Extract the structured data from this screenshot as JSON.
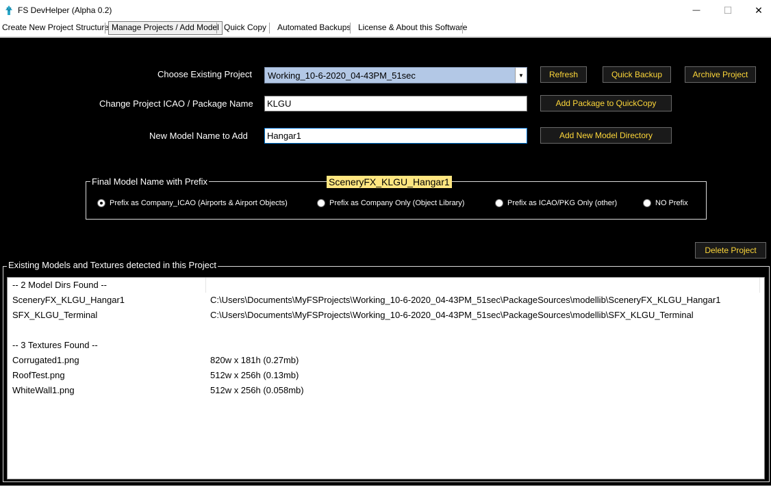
{
  "window": {
    "title": "FS DevHelper (Alpha 0.2)",
    "minimize_glyph": "—",
    "maximize_glyph": "☐",
    "close_glyph": "✕"
  },
  "tabs": [
    {
      "label": "Create New Project Structure",
      "active": false
    },
    {
      "label": "Manage Projects / Add Model",
      "active": true
    },
    {
      "label": "Quick Copy",
      "active": false
    },
    {
      "label": "Automated Backups",
      "active": false
    },
    {
      "label": "License & About this Software",
      "active": false
    }
  ],
  "form": {
    "choose_project_label": "Choose Existing Project",
    "choose_project_value": "Working_10-6-2020_04-43PM_51sec",
    "change_icao_label": "Change Project ICAO / Package Name",
    "change_icao_value": "KLGU",
    "new_model_label": "New Model Name to Add",
    "new_model_value": "Hangar1"
  },
  "buttons": {
    "refresh": "Refresh",
    "quick_backup": "Quick Backup",
    "archive_project": "Archive Project",
    "add_package": "Add Package to QuickCopy",
    "add_model_dir": "Add New Model Directory",
    "delete_project": "Delete Project"
  },
  "prefix_group": {
    "legend": "Final Model Name with Prefix",
    "final_name": "SceneryFX_KLGU_Hangar1",
    "options": [
      {
        "label": "Prefix as Company_ICAO (Airports & Airport Objects)",
        "checked": true
      },
      {
        "label": "Prefix as Company Only (Object Library)",
        "checked": false
      },
      {
        "label": "Prefix as ICAO/PKG Only (other)",
        "checked": false
      },
      {
        "label": "NO Prefix",
        "checked": false
      }
    ]
  },
  "models_group": {
    "legend": "Existing Models and Textures detected in this Project",
    "rows": [
      {
        "name": "-- 2 Model Dirs Found --",
        "detail": ""
      },
      {
        "name": "SceneryFX_KLGU_Hangar1",
        "detail": "C:\\Users\\Documents\\MyFSProjects\\Working_10-6-2020_04-43PM_51sec\\PackageSources\\modellib\\SceneryFX_KLGU_Hangar1"
      },
      {
        "name": "SFX_KLGU_Terminal",
        "detail": "C:\\Users\\Documents\\MyFSProjects\\Working_10-6-2020_04-43PM_51sec\\PackageSources\\modellib\\SFX_KLGU_Terminal"
      },
      {
        "name": "",
        "detail": ""
      },
      {
        "name": "-- 3 Textures Found --",
        "detail": ""
      },
      {
        "name": "Corrugated1.png",
        "detail": "820w x 181h (0.27mb)"
      },
      {
        "name": "RoofTest.png",
        "detail": "512w x 256h (0.13mb)"
      },
      {
        "name": "WhiteWall1.png",
        "detail": "512w x 256h (0.058mb)"
      }
    ]
  },
  "colors": {
    "panel_bg": "#000000",
    "button_text": "#ffd83a",
    "dropdown_bg": "#b3c8e6",
    "badge_bg": "#ffe680"
  }
}
